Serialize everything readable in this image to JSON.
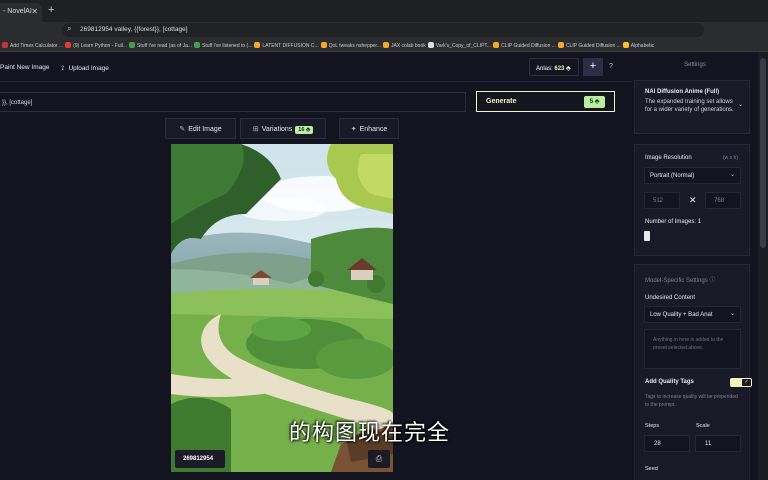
{
  "browser": {
    "tab_title": "- NovelAI",
    "close_symbol": "✕",
    "new_tab_symbol": "+",
    "address": "269812954 valley, {{forest}}, [cottage]",
    "bookmarks": [
      {
        "label": "Add Times Calculator ...",
        "color": "#c0392b"
      },
      {
        "label": "(9) Learn Python - Full...",
        "color": "#e53935"
      },
      {
        "label": "Stuff i've read (as of Ja...",
        "color": "#43a047"
      },
      {
        "label": "Stuff i've listened to (...",
        "color": "#43a047"
      },
      {
        "label": "LATENT DIFFUSION C...",
        "color": "#f9a825"
      },
      {
        "label": "QoL tweaks nshepper...",
        "color": "#f9a825"
      },
      {
        "label": "JAX colab book",
        "color": "#f9a825"
      },
      {
        "label": "Vark's_Copy_of_CLIPT...",
        "color": "#dddddd"
      },
      {
        "label": "CLIP Guided Diffusion ...",
        "color": "#f9a825"
      },
      {
        "label": "CLIP Guided Diffusion ...",
        "color": "#f9a825"
      },
      {
        "label": "Alphabetic",
        "color": "#fbc02d"
      }
    ]
  },
  "topnav": {
    "paint_new_image": "Paint New Image",
    "upload_image": "Upload Image",
    "anlas_label": "Anlas:",
    "anlas_value": "623",
    "plus": "+",
    "help": "?"
  },
  "prompt": {
    "text": "}}, [cottage]"
  },
  "generate": {
    "label": "Generate",
    "cost": "5"
  },
  "tools": {
    "edit_image": "Edit Image",
    "variations": "Variations",
    "variations_cost": "16",
    "enhance": "Enhance"
  },
  "image": {
    "seed": "269812954"
  },
  "subtitle": "的构图现在完全",
  "settings": {
    "title": "Settings",
    "model_name": "NAI Diffusion Anime (Full)",
    "model_desc": "The expanded training set allows for a wider variety of generations.",
    "image_resolution_label": "Image Resolution",
    "resolution_unit": "(w x h)",
    "resolution_preset": "Portrait (Normal)",
    "width": "512",
    "height": "768",
    "times": "✕",
    "num_images_label": "Number of Images:",
    "num_images": "1",
    "model_specific_label": "Model-Specific Settings",
    "undesired_label": "Undesired Content",
    "undesired_preset": "Low Quality + Bad Anat",
    "undesired_placeholder": "Anything in here is added to the preset selected above.",
    "quality_tags_label": "Add Quality Tags",
    "quality_tags_desc": "Tags to increase quality will be prepended to the prompt.",
    "steps_label": "Steps",
    "steps": "28",
    "scale_label": "Scale",
    "scale": "11",
    "seed_label": "Seed"
  }
}
